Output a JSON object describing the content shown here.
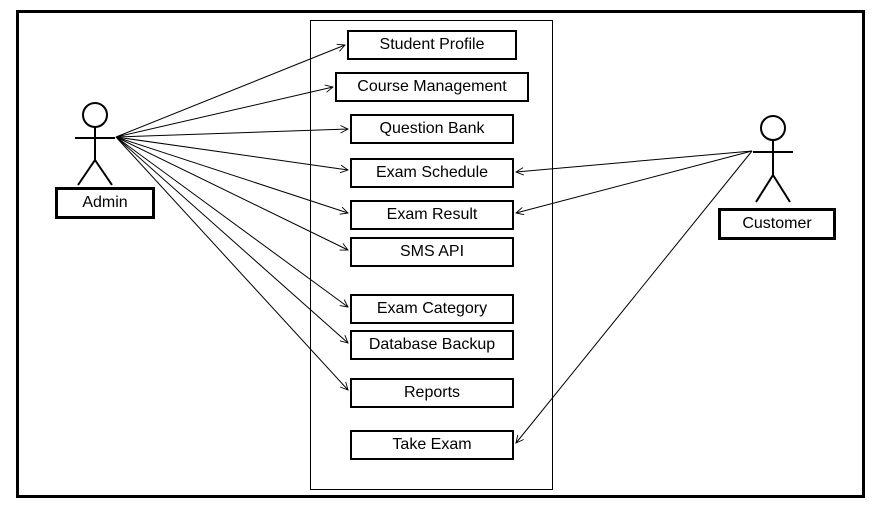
{
  "actors": {
    "left": {
      "label": "Admin"
    },
    "right": {
      "label": "Customer"
    }
  },
  "usecases": [
    {
      "label": "Student Profile"
    },
    {
      "label": "Course Management"
    },
    {
      "label": "Question Bank"
    },
    {
      "label": "Exam Schedule"
    },
    {
      "label": "Exam Result"
    },
    {
      "label": "SMS API"
    },
    {
      "label": "Exam Category"
    },
    {
      "label": "Database Backup"
    },
    {
      "label": "Reports"
    },
    {
      "label": "Take Exam"
    }
  ],
  "chart_data": {
    "type": "diagram",
    "diagram_kind": "uml-use-case",
    "title": "",
    "actors": [
      "Admin",
      "Customer"
    ],
    "use_cases": [
      "Student Profile",
      "Course Management",
      "Question Bank",
      "Exam Schedule",
      "Exam Result",
      "SMS API",
      "Exam Category",
      "Database Backup",
      "Reports",
      "Take Exam"
    ],
    "associations": [
      {
        "actor": "Admin",
        "use_case": "Student Profile"
      },
      {
        "actor": "Admin",
        "use_case": "Course Management"
      },
      {
        "actor": "Admin",
        "use_case": "Question Bank"
      },
      {
        "actor": "Admin",
        "use_case": "Exam Schedule"
      },
      {
        "actor": "Admin",
        "use_case": "Exam Result"
      },
      {
        "actor": "Admin",
        "use_case": "SMS API"
      },
      {
        "actor": "Admin",
        "use_case": "Exam Category"
      },
      {
        "actor": "Admin",
        "use_case": "Database Backup"
      },
      {
        "actor": "Admin",
        "use_case": "Reports"
      },
      {
        "actor": "Customer",
        "use_case": "Exam Schedule"
      },
      {
        "actor": "Customer",
        "use_case": "Exam Result"
      },
      {
        "actor": "Customer",
        "use_case": "Take Exam"
      }
    ]
  }
}
